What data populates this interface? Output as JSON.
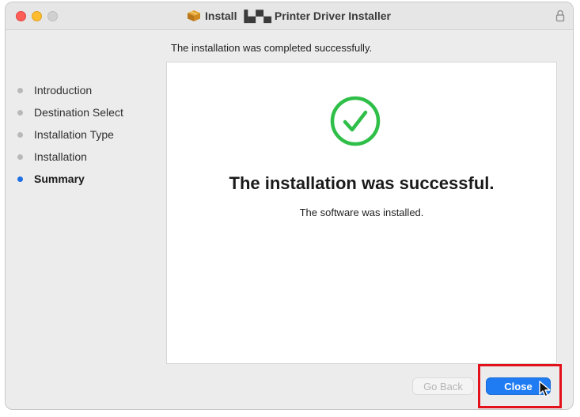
{
  "window": {
    "title": "Install ▐▄▀▄ Printer Driver Installer"
  },
  "page": {
    "subtitle": "The installation was completed successfully."
  },
  "sidebar": {
    "steps": [
      {
        "label": "Introduction",
        "current": false
      },
      {
        "label": "Destination Select",
        "current": false
      },
      {
        "label": "Installation Type",
        "current": false
      },
      {
        "label": "Installation",
        "current": false
      },
      {
        "label": "Summary",
        "current": true
      }
    ]
  },
  "main": {
    "heading": "The installation was successful.",
    "message": "The software was installed."
  },
  "buttons": {
    "back_label": "Go Back",
    "close_label": "Close"
  },
  "colors": {
    "success_green": "#2fbf48",
    "accent_blue": "#1f7cf2",
    "highlight_red": "#e3111b"
  },
  "icons": {
    "title": "package-icon",
    "lock": "lock-icon",
    "success": "checkmark-circle-icon",
    "cursor": "pointer-cursor-icon"
  }
}
